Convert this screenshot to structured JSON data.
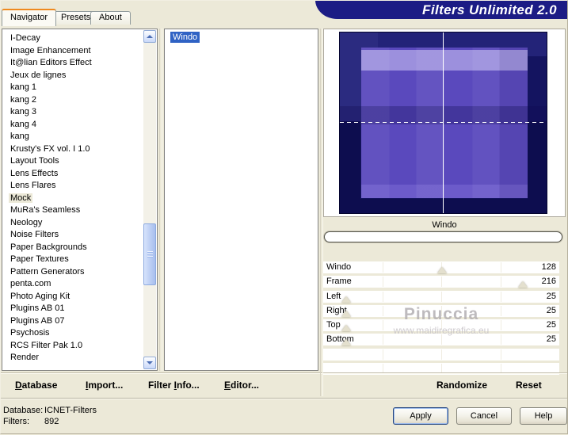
{
  "window": {
    "title": "Filters Unlimited 2.0"
  },
  "tabs": [
    {
      "label": "Navigator",
      "active": true
    },
    {
      "label": "Presets",
      "active": false
    },
    {
      "label": "About",
      "active": false
    }
  ],
  "category_list": {
    "items": [
      "I-Decay",
      "Image Enhancement",
      "It@lian Editors Effect",
      "Jeux de lignes",
      "kang 1",
      "kang 2",
      "kang 3",
      "kang 4",
      "kang",
      "Krusty's FX vol. I 1.0",
      "Layout Tools",
      "Lens Effects",
      "Lens Flares",
      "Mock",
      "MuRa's Seamless",
      "Neology",
      "Noise Filters",
      "Paper Backgrounds",
      "Paper Textures",
      "Pattern Generators",
      "penta.com",
      "Photo Aging Kit",
      "Plugins AB 01",
      "Plugins AB 07",
      "Psychosis",
      "RCS Filter Pak 1.0",
      "Render"
    ],
    "selected": "Mock"
  },
  "filter_list": {
    "items": [
      "Windo"
    ],
    "selected": "Windo"
  },
  "preview": {
    "caption": "Windo",
    "progress_percent": 0
  },
  "slider_area": {
    "empty_rows": 2
  },
  "sliders": [
    {
      "label": "Windo",
      "value": 128,
      "max": 255
    },
    {
      "label": "Frame",
      "value": 216,
      "max": 255
    },
    {
      "label": "Left",
      "value": 25,
      "max": 255
    },
    {
      "label": "Right",
      "value": 25,
      "max": 255
    },
    {
      "label": "Top",
      "value": 25,
      "max": 255
    },
    {
      "label": "Bottom",
      "value": 25,
      "max": 255
    }
  ],
  "watermark": {
    "line1": "Pinuccia",
    "line2": "www.maidiregrafica.eu"
  },
  "actions": [
    {
      "name": "database",
      "pre": "",
      "u": "D",
      "post": "atabase"
    },
    {
      "name": "import",
      "pre": "",
      "u": "I",
      "post": "mport..."
    },
    {
      "name": "filter-info",
      "pre": "Filter ",
      "u": "I",
      "post": "nfo..."
    },
    {
      "name": "editor",
      "pre": "",
      "u": "E",
      "post": "ditor..."
    },
    {
      "name": "randomize",
      "pre": "",
      "u": "",
      "post": "Randomize"
    },
    {
      "name": "reset",
      "pre": "",
      "u": "",
      "post": "Reset"
    }
  ],
  "status_bar": {
    "rows": [
      {
        "label": "Database:",
        "value": "ICNET-Filters"
      },
      {
        "label": "Filters:",
        "value": "892"
      }
    ]
  },
  "dialog_buttons": [
    {
      "label": "Apply",
      "default": true
    },
    {
      "label": "Cancel",
      "default": false
    },
    {
      "label": "Help",
      "default": false
    }
  ],
  "colors": {
    "chrome_bg": "#ECE9D8",
    "banner_bg": "#1C1C85",
    "banner_text": "#FFFFFF",
    "tab_accent": "#EF8A1F",
    "selection_bg": "#2F62C4",
    "selection_text": "#FFFFFF",
    "unfocused_selection_bg": "#ECE9D8",
    "panel_bg": "#FFFFFF",
    "preview_frame": "#141460",
    "preview_frame_dark": "#0D0D4F",
    "preview_frame_light": "#232378",
    "preview_body": "#5A49BD",
    "preview_band_light": "#9C90DD",
    "preview_band_bottom": "#6C5BCA",
    "crosshair": "#FFFFFF",
    "scrollbar_thumb": "#B9CCF3",
    "scrollbar_border": "#8CAAE0",
    "watermark": "#AFABAF"
  }
}
